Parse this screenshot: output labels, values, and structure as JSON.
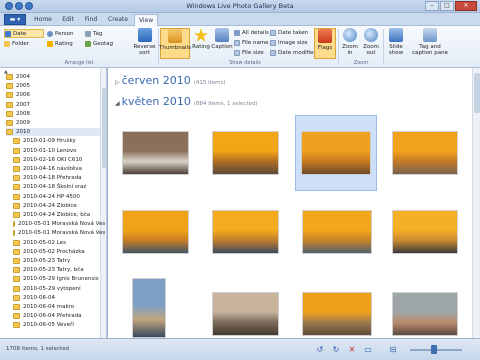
{
  "window": {
    "title": "Windows Live Photo Gallery Beta",
    "controls": [
      "–",
      "□",
      "✕"
    ]
  },
  "tabs": [
    {
      "label": "Home",
      "active": false
    },
    {
      "label": "Edit",
      "active": false
    },
    {
      "label": "Find",
      "active": false
    },
    {
      "label": "Create",
      "active": false
    },
    {
      "label": "View",
      "active": true
    }
  ],
  "ribbon": {
    "arrange": {
      "label": "Arrange list",
      "items": {
        "date": "Date",
        "person": "Person",
        "tag": "Tag",
        "folder": "Folder",
        "rating": "Rating",
        "geotag": "Geotag"
      },
      "reverse_sort": "Reverse sort"
    },
    "show_details": {
      "label": "Show details",
      "thumbnails": "Thumbnails",
      "rating": "Rating",
      "caption": "Caption",
      "all_details": "All details",
      "file_name": "File name",
      "file_size": "File size",
      "date_taken": "Date taken",
      "image_size": "Image size",
      "date_modified": "Date modified",
      "flags": "Flags"
    },
    "zoom": {
      "label": "Zoom",
      "zoom_in": "Zoom in",
      "zoom_out": "Zoom out"
    },
    "slide_show": "Slide show",
    "tag_caption_pane": "Tag and caption pane"
  },
  "sidebar": {
    "up_arrow": "▲",
    "items": [
      {
        "label": "2004",
        "indent": 0,
        "selected": false
      },
      {
        "label": "2005",
        "indent": 0,
        "selected": false
      },
      {
        "label": "2006",
        "indent": 0,
        "selected": false
      },
      {
        "label": "2007",
        "indent": 0,
        "selected": false
      },
      {
        "label": "2008",
        "indent": 0,
        "selected": false
      },
      {
        "label": "2009",
        "indent": 0,
        "selected": false
      },
      {
        "label": "2010",
        "indent": 0,
        "selected": true
      },
      {
        "label": "2010-01-09 Hrušky",
        "indent": 1,
        "selected": false
      },
      {
        "label": "2010-01-10 Lenovo",
        "indent": 1,
        "selected": false
      },
      {
        "label": "2010-02-16 OKI C610",
        "indent": 1,
        "selected": false
      },
      {
        "label": "2010-04-16 návštěva",
        "indent": 1,
        "selected": false
      },
      {
        "label": "2010-04-18 Přehrada",
        "indent": 1,
        "selected": false
      },
      {
        "label": "2010-04-18 Školní sraz",
        "indent": 1,
        "selected": false
      },
      {
        "label": "2010-04-24 HP 4500",
        "indent": 1,
        "selected": false
      },
      {
        "label": "2010-04-24 Zlobice",
        "indent": 1,
        "selected": false
      },
      {
        "label": "2010-04-24 Zlobice, bča",
        "indent": 1,
        "selected": false
      },
      {
        "label": "2010-05-01 Moravská Nová Ves",
        "indent": 1,
        "selected": false
      },
      {
        "label": "2010-05-01 Moravská Nová Ves",
        "indent": 1,
        "selected": false
      },
      {
        "label": "2010-05-02 Les",
        "indent": 1,
        "selected": false
      },
      {
        "label": "2010-05-02 Procházka",
        "indent": 1,
        "selected": false
      },
      {
        "label": "2010-05-23 Tatry",
        "indent": 1,
        "selected": false
      },
      {
        "label": "2010-05-23 Tatry, bča",
        "indent": 1,
        "selected": false
      },
      {
        "label": "2010-05-29 Ignis Brunensis",
        "indent": 1,
        "selected": false
      },
      {
        "label": "2010-05-29 vytopení",
        "indent": 1,
        "selected": false
      },
      {
        "label": "2010-06-04",
        "indent": 1,
        "selected": false
      },
      {
        "label": "2010-06-04 makro",
        "indent": 1,
        "selected": false
      },
      {
        "label": "2010-06-04 Přehrada",
        "indent": 1,
        "selected": false
      },
      {
        "label": "2010-06-05 Veveří",
        "indent": 1,
        "selected": false
      }
    ]
  },
  "sections": [
    {
      "title": "červen 2010",
      "count": "(415 items)",
      "caret": "▷"
    },
    {
      "title": "květen 2010",
      "count": "(884 items, 1 selected)",
      "caret": "◢"
    }
  ],
  "photos": [
    {
      "name": "photo-1",
      "colors": [
        "#8a6f5a",
        "#d9d2c7",
        "#4d4036"
      ],
      "selected": false
    },
    {
      "name": "photo-2",
      "colors": [
        "#f2a516",
        "#b06d22",
        "#5d4a3a"
      ],
      "selected": false
    },
    {
      "name": "photo-3",
      "colors": [
        "#f0a020",
        "#c77a1e",
        "#6a4b2c"
      ],
      "selected": true
    },
    {
      "name": "photo-4",
      "colors": [
        "#f3a21b",
        "#c27a28",
        "#7b6350"
      ],
      "selected": false
    },
    {
      "name": "photo-5",
      "colors": [
        "#f1a318",
        "#c67d24",
        "#445566"
      ],
      "selected": false
    },
    {
      "name": "photo-6",
      "colors": [
        "#f4ab1d",
        "#bf7c2c",
        "#3e4b5e"
      ],
      "selected": false
    },
    {
      "name": "photo-7",
      "colors": [
        "#f2a61b",
        "#c98328",
        "#526070"
      ],
      "selected": false
    },
    {
      "name": "photo-8",
      "colors": [
        "#f5b025",
        "#c98a31",
        "#3a3a3a"
      ],
      "selected": false
    },
    {
      "name": "photo-9",
      "colors": [
        "#7ea0c6",
        "#c0a57c",
        "#384a60"
      ],
      "selected": false
    },
    {
      "name": "photo-10",
      "colors": [
        "#c8b39c",
        "#7a6a5a",
        "#44392f"
      ],
      "selected": false
    },
    {
      "name": "photo-11",
      "colors": [
        "#f0a11c",
        "#9d7a4e",
        "#5e4c3a"
      ],
      "selected": false
    },
    {
      "name": "photo-12",
      "colors": [
        "#9fa6a9",
        "#b98b6a",
        "#5d4c43"
      ],
      "selected": false
    },
    {
      "name": "photo-13",
      "colors": [
        "#6a8f52",
        "#c88b6a",
        "#3e3a36"
      ],
      "selected": false
    }
  ],
  "status": {
    "text": "1708 items, 1 selected",
    "icons": [
      "↺",
      "↻",
      "✕",
      "▭",
      "⊟"
    ]
  },
  "colors": {
    "accent": "#3a6ab0",
    "selection": "#cde0f7",
    "ribbon_highlight": "#fcdc8a"
  }
}
